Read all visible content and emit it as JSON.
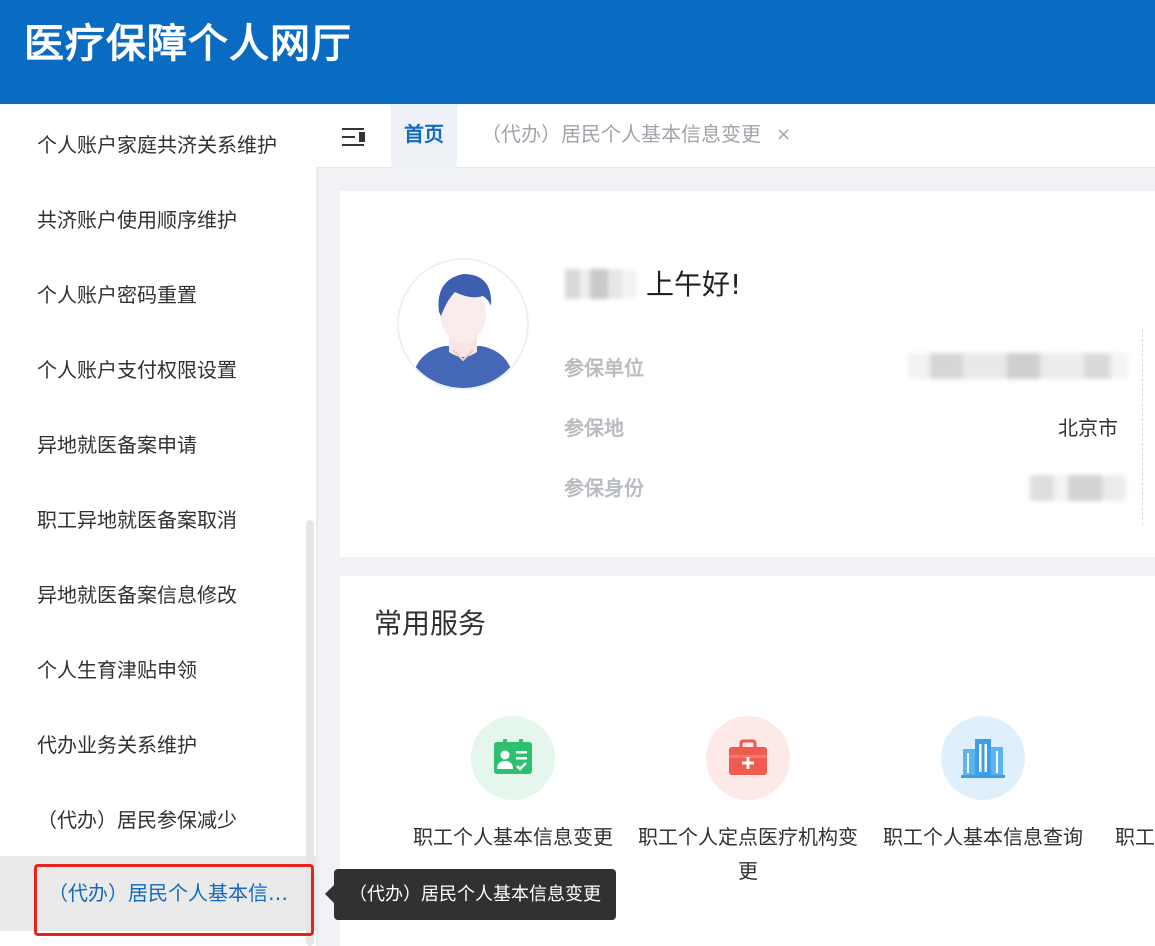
{
  "header": {
    "title": "医疗保障个人网厅"
  },
  "sidebar": {
    "items": [
      {
        "label": "个人账户家庭共济关系维护"
      },
      {
        "label": "共济账户使用顺序维护"
      },
      {
        "label": "个人账户密码重置"
      },
      {
        "label": "个人账户支付权限设置"
      },
      {
        "label": "异地就医备案申请"
      },
      {
        "label": "职工异地就医备案取消"
      },
      {
        "label": "异地就医备案信息修改"
      },
      {
        "label": "个人生育津贴申领"
      },
      {
        "label": "代办业务关系维护"
      },
      {
        "label": "（代办）居民参保减少"
      },
      {
        "label": "（代办）居民个人基本信息变更",
        "active": true
      }
    ]
  },
  "tabs": {
    "home": "首页",
    "other": "（代办）居民个人基本信息变更",
    "close": "×"
  },
  "profile": {
    "greeting": "上午好!",
    "fields": [
      {
        "label": "参保单位",
        "value": ""
      },
      {
        "label": "参保地",
        "value": "北京市"
      },
      {
        "label": "参保身份",
        "value": ""
      }
    ]
  },
  "services": {
    "title": "常用服务",
    "items": [
      {
        "label": "职工个人基本信息变更",
        "icon": "id-card-icon",
        "color": "#2fbf71",
        "bg": "#e5f6ec"
      },
      {
        "label": "职工个人定点医疗机构变更",
        "icon": "medical-kit-icon",
        "color": "#f05a4f",
        "bg": "#fde9e6"
      },
      {
        "label": "职工个人基本信息查询",
        "icon": "building-icon",
        "color": "#3a9fe8",
        "bg": "#dff0fc"
      },
      {
        "label": "职工",
        "icon": "",
        "color": "",
        "bg": ""
      }
    ]
  },
  "tooltip": {
    "text": "（代办）居民个人基本信息变更"
  },
  "colors": {
    "brand": "#0a6bc2",
    "active_text": "#1369c0",
    "highlight": "#e6231e"
  }
}
